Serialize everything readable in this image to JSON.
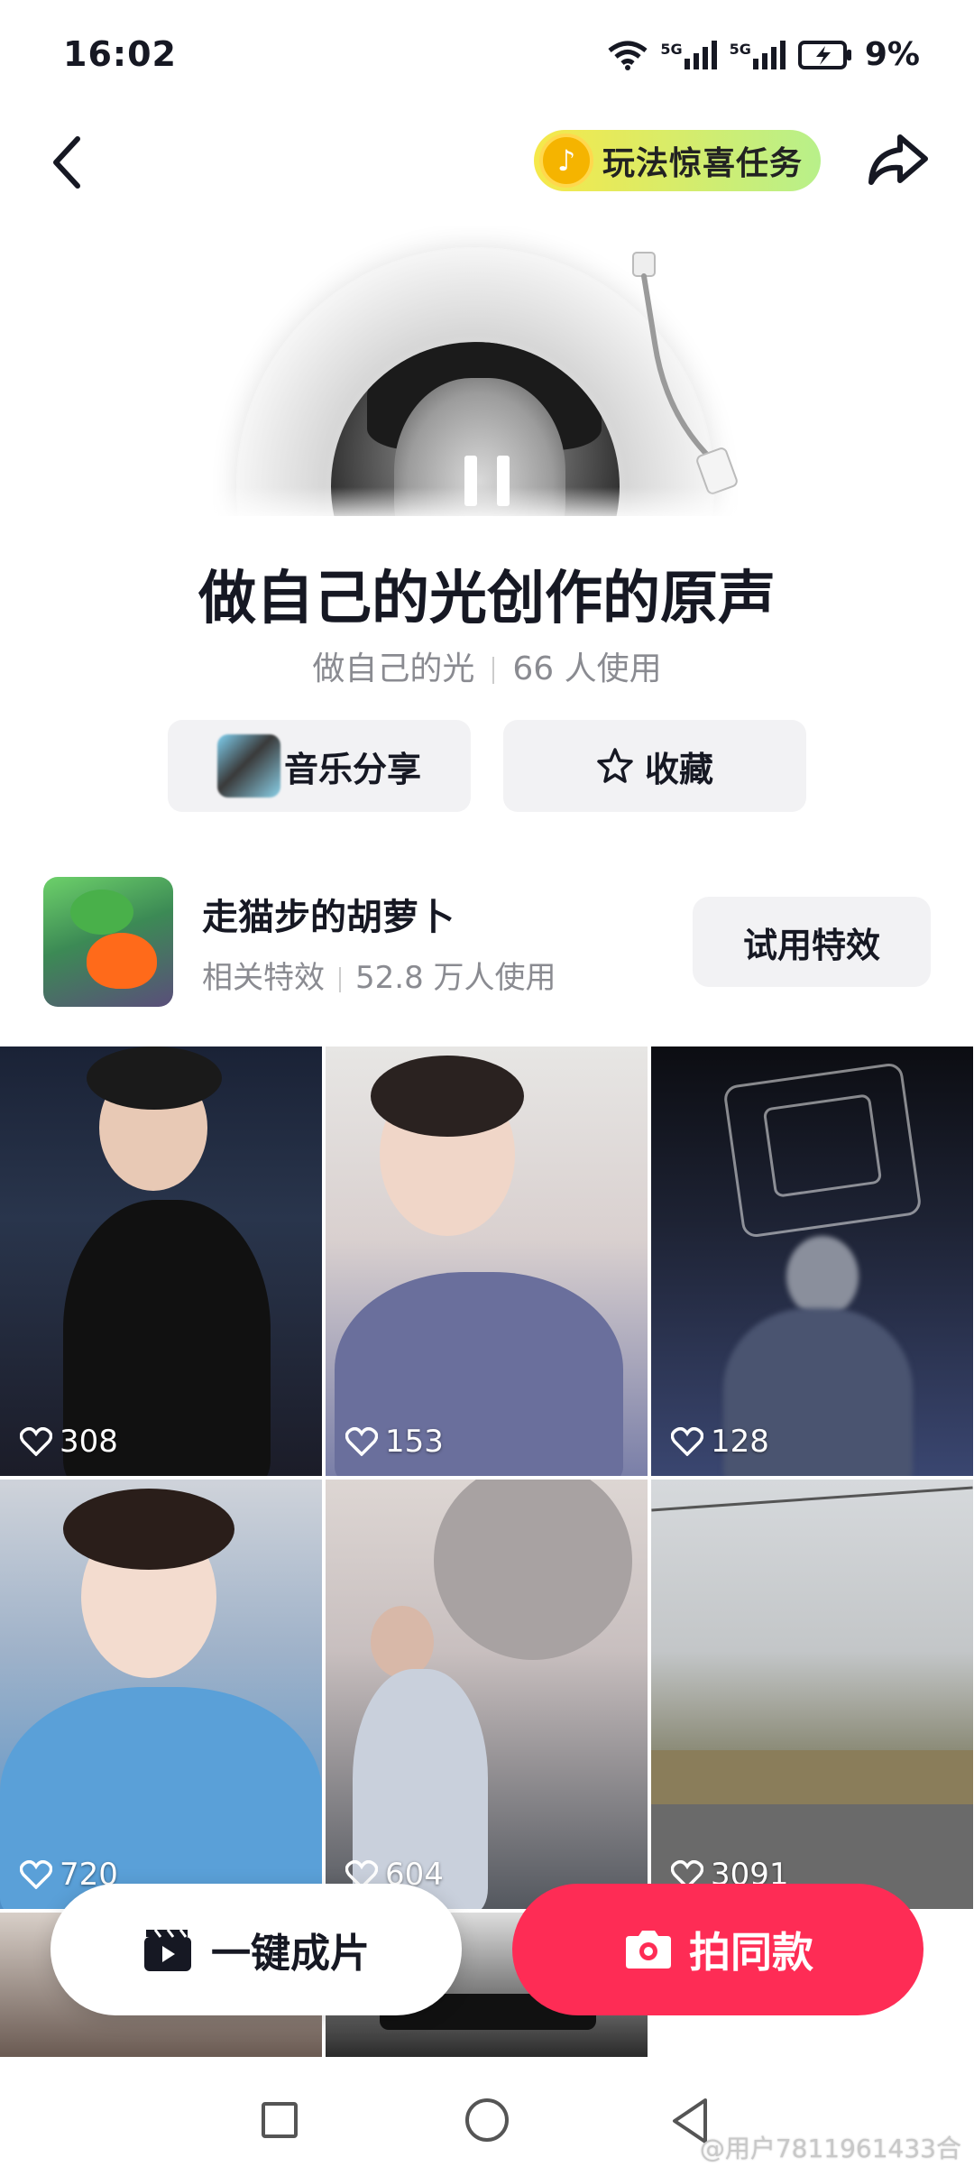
{
  "status_bar": {
    "time": "16:02",
    "network_1": "5G",
    "network_2": "5G",
    "battery": "9%"
  },
  "header": {
    "promo_label": "玩法惊喜任务",
    "promo_icon": "tiktok-note-icon",
    "back_icon": "chevron-left-icon",
    "share_icon": "share-arrow-icon"
  },
  "song": {
    "title": "做自己的光创作的原声",
    "artist": "做自己的光",
    "usage": "66 人使用"
  },
  "actions": {
    "music_share": "音乐分享",
    "collect": "收藏"
  },
  "effect": {
    "name": "走猫步的胡萝卜",
    "category": "相关特效",
    "usage": "52.8 万人使用",
    "try_label": "试用特效"
  },
  "videos": [
    {
      "likes": "308"
    },
    {
      "likes": "153"
    },
    {
      "likes": "128"
    },
    {
      "likes": "720"
    },
    {
      "likes": "604"
    },
    {
      "likes": "3091"
    }
  ],
  "bottom_actions": {
    "one_click": "一键成片",
    "shoot_same": "拍同款"
  },
  "watermark": "@用户7811961433合",
  "colors": {
    "accent": "#fe2c55",
    "button_bg": "#f2f2f4",
    "muted_text": "#8a8b91"
  }
}
